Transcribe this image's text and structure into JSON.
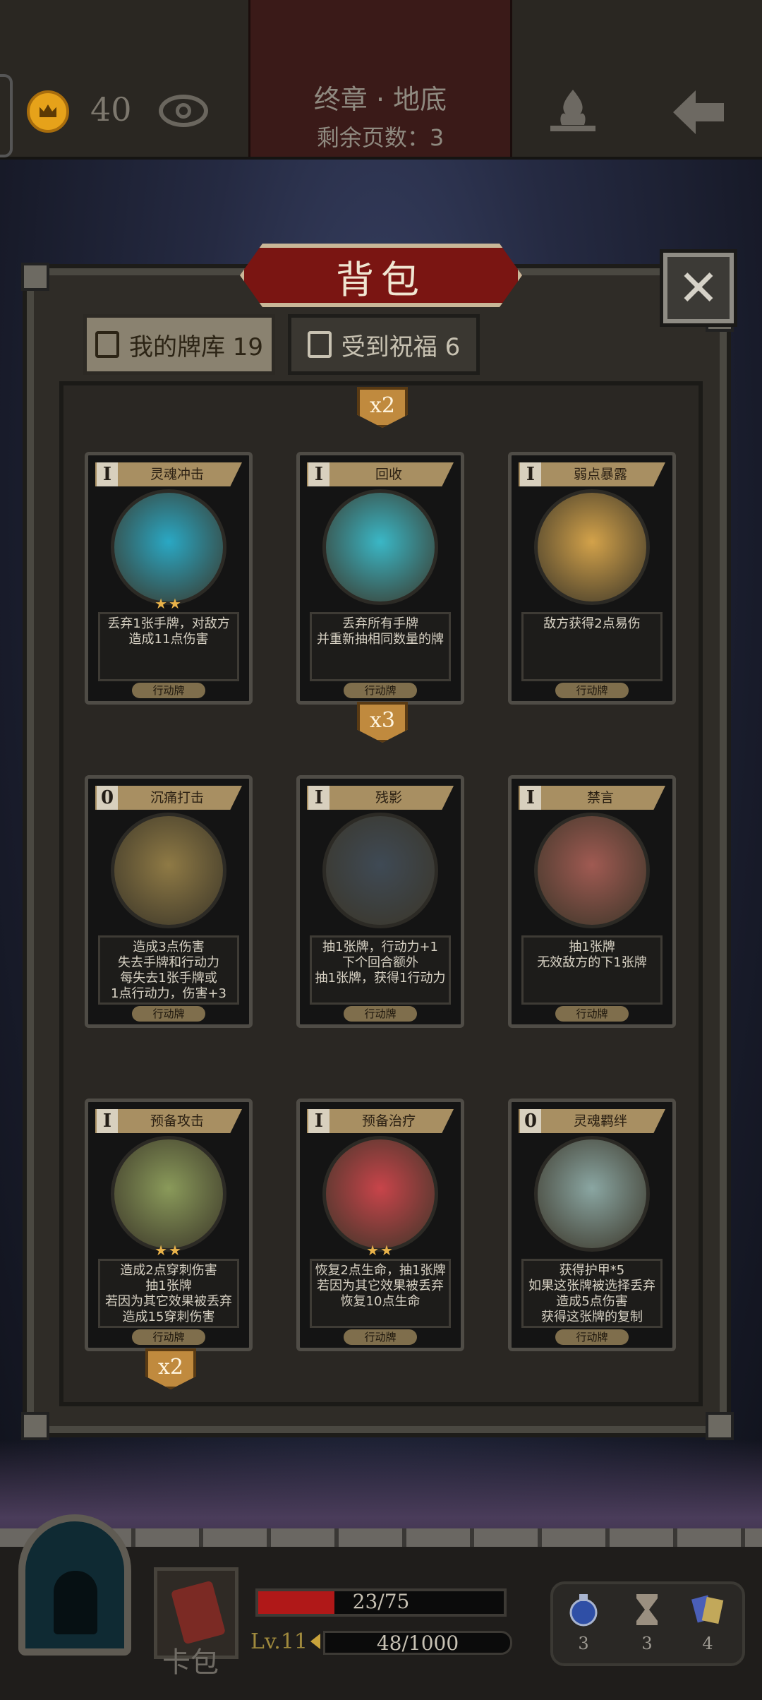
{
  "header": {
    "coins": "40",
    "chapter_title": "终章 · 地底",
    "pages_left": "剩余页数：3"
  },
  "panel": {
    "title": "背包",
    "close_label": "✕",
    "tabs": [
      {
        "label": "我的牌库 19",
        "active": true
      },
      {
        "label": "受到祝福 6",
        "active": false
      }
    ]
  },
  "cards": [
    {
      "name": "灵魂冲击",
      "cost": "Ⅰ",
      "stars": "★★",
      "desc": "丢弃1张手牌，对敌方\n造成11点伤害",
      "type": "行动牌",
      "art_color": "#2aa8c4"
    },
    {
      "name": "回收",
      "cost": "Ⅰ",
      "stars": "",
      "desc": "丢弃所有手牌\n并重新抽相同数量的牌",
      "type": "行动牌",
      "art_color": "#3ab7c6"
    },
    {
      "name": "弱点暴露",
      "cost": "Ⅰ",
      "stars": "",
      "desc": "敌方获得2点易伤",
      "type": "行动牌",
      "art_color": "#d3a24a"
    },
    {
      "name": "沉痛打击",
      "cost": "0",
      "stars": "",
      "desc": "造成3点伤害\n失去手牌和行动力\n每失去1张手牌或\n1点行动力，伤害+3",
      "type": "行动牌",
      "art_color": "#8f7a45"
    },
    {
      "name": "残影",
      "cost": "Ⅰ",
      "stars": "",
      "desc": "抽1张牌，行动力+1\n下个回合额外\n抽1张牌，获得1行动力",
      "type": "行动牌",
      "art_color": "#3f4a55"
    },
    {
      "name": "禁言",
      "cost": "Ⅰ",
      "stars": "",
      "desc": "抽1张牌\n无效敌方的下1张牌",
      "type": "行动牌",
      "art_color": "#a05a52"
    },
    {
      "name": "预备攻击",
      "cost": "Ⅰ",
      "stars": "★★",
      "desc": "造成2点穿刺伤害\n抽1张牌\n若因为其它效果被丢弃\n造成15穿刺伤害",
      "type": "行动牌",
      "art_color": "#8a9a5a"
    },
    {
      "name": "预备治疗",
      "cost": "Ⅰ",
      "stars": "★★",
      "desc": "恢复2点生命，抽1张牌\n若因为其它效果被丢弃\n恢复10点生命",
      "type": "行动牌",
      "art_color": "#c8444a"
    },
    {
      "name": "灵魂羁绊",
      "cost": "0",
      "stars": "",
      "desc": "获得护甲*5\n如果这张牌被选择丢弃\n造成5点伤害\n获得这张牌的复制",
      "type": "行动牌",
      "art_color": "#8aa6a2"
    }
  ],
  "badges": [
    "x2",
    "x3",
    "x2"
  ],
  "hud": {
    "bag_label": "卡包",
    "hp": "23/75",
    "hp_fraction": 0.31,
    "level": "Lv.11",
    "xp": "48/1000",
    "xp_fraction": 0.048,
    "resources": [
      "3",
      "3",
      "4"
    ]
  },
  "colors": {
    "accent_red": "#7a1512",
    "gold": "#e6a21a",
    "hp_red": "#b01818"
  }
}
